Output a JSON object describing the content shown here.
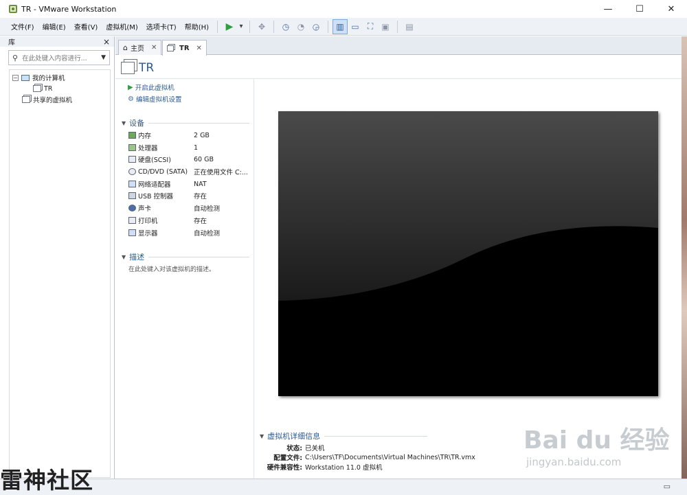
{
  "window": {
    "title": "TR - VMware Workstation",
    "controls": {
      "minimize": "—",
      "maximize": "☐",
      "close": "✕"
    }
  },
  "menu": {
    "items": [
      "文件(F)",
      "编辑(E)",
      "查看(V)",
      "虚拟机(M)",
      "选项卡(T)",
      "帮助(H)"
    ]
  },
  "toolbar": {
    "play_icon": "▶",
    "dropdown_icon": "▾"
  },
  "sidebar": {
    "title": "库",
    "close": "×",
    "search_placeholder": "在此处键入内容进行...",
    "tree": {
      "my_computer": "我的计算机",
      "vm": "TR",
      "shared": "共享的虚拟机"
    }
  },
  "tabs": [
    {
      "label": "主页",
      "icon": "home-icon"
    },
    {
      "label": "TR",
      "icon": "vm-icon"
    }
  ],
  "vm": {
    "name": "TR",
    "actions": {
      "power_on": "开启此虚拟机",
      "edit_settings": "编辑虚拟机设置"
    },
    "devices_header": "设备",
    "devices": [
      {
        "name": "内存",
        "value": "2 GB",
        "icon": "memory-icon"
      },
      {
        "name": "处理器",
        "value": "1",
        "icon": "cpu-icon"
      },
      {
        "name": "硬盘(SCSI)",
        "value": "60 GB",
        "icon": "disk-icon"
      },
      {
        "name": "CD/DVD (SATA)",
        "value": "正在使用文件 C:...",
        "icon": "cd-icon"
      },
      {
        "name": "网络适配器",
        "value": "NAT",
        "icon": "network-icon"
      },
      {
        "name": "USB 控制器",
        "value": "存在",
        "icon": "usb-icon"
      },
      {
        "name": "声卡",
        "value": "自动检测",
        "icon": "sound-icon"
      },
      {
        "name": "打印机",
        "value": "存在",
        "icon": "printer-icon"
      },
      {
        "name": "显示器",
        "value": "自动检测",
        "icon": "display-icon"
      }
    ],
    "description_header": "描述",
    "description_placeholder": "在此处键入对该虚拟机的描述。",
    "details_header": "虚拟机详细信息",
    "details": [
      {
        "key": "状态:",
        "value": "已关机"
      },
      {
        "key": "配置文件:",
        "value": "C:\\Users\\TF\\Documents\\Virtual Machines\\TR\\TR.vmx"
      },
      {
        "key": "硬件兼容性:",
        "value": "Workstation 11.0 虚拟机"
      }
    ]
  },
  "watermarks": {
    "left": "雷神社区",
    "baidu_logo": "Bai du 经验",
    "baidu_url": "jingyan.baidu.com"
  }
}
